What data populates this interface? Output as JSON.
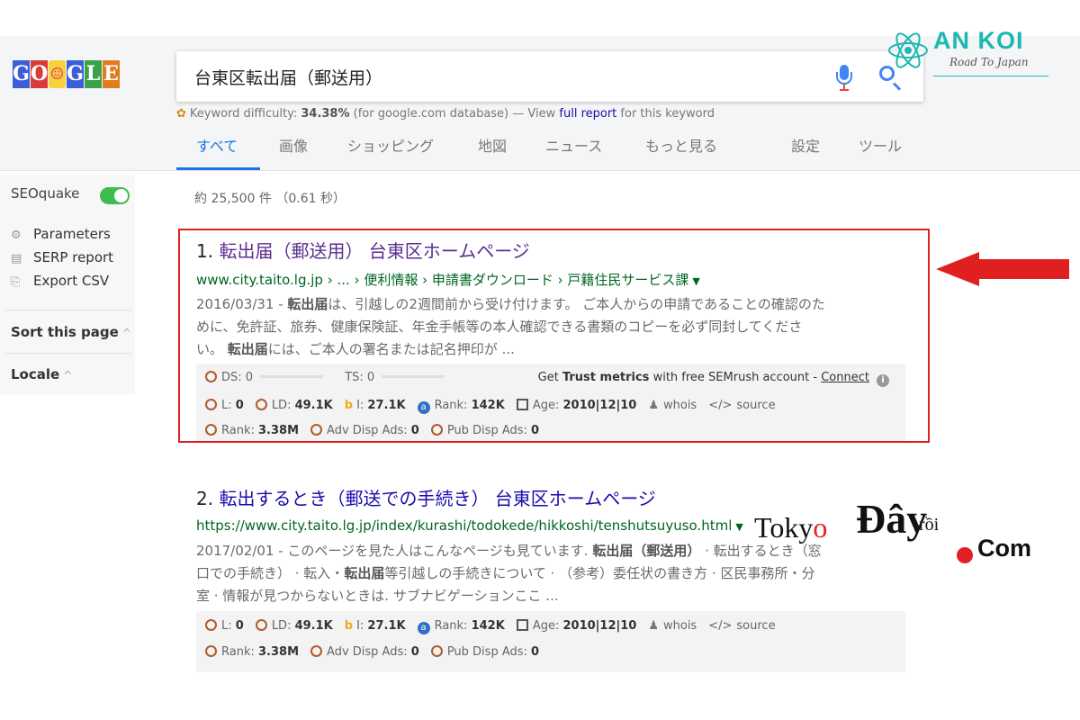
{
  "logo": {
    "letters": [
      "G",
      "O",
      "☺",
      "G",
      "L",
      "E"
    ],
    "colors": [
      "#3b5fd9",
      "#d93b3b",
      "#f6d33c",
      "#3b5fd9",
      "#3aa24a",
      "#e07c1e"
    ]
  },
  "search": {
    "query": "台東区転出届（郵送用）",
    "mic_icon": "mic-icon",
    "search_icon": "search-icon"
  },
  "keyword": {
    "prefix": "Keyword difficulty:",
    "value": "34.38%",
    "db": "(for google.com database) — View",
    "link": "full report",
    "suffix": "for this keyword"
  },
  "tabs": [
    "すべて",
    "画像",
    "ショッピング",
    "地図",
    "ニュース",
    "もっと見る",
    "設定",
    "ツール"
  ],
  "brand": {
    "name": "AN KOI",
    "tagline": "Road To Japan",
    "color": "#1db8b0"
  },
  "sidebar": {
    "seoquake": "SEOquake",
    "items": [
      {
        "icon": "gear-icon",
        "glyph": "⚙",
        "label": "Parameters"
      },
      {
        "icon": "report-icon",
        "glyph": "▤",
        "label": "SERP report"
      },
      {
        "icon": "export-icon",
        "glyph": "⎘",
        "label": "Export CSV"
      }
    ],
    "sort": "Sort this page",
    "locale": "Locale"
  },
  "stats": "約 25,500 件 （0.61 秒）",
  "results": [
    {
      "num": "1.",
      "title": "転出届（郵送用） 台東区ホームページ",
      "url": "www.city.taito.lg.jp › ... › 便利情報 › 申請書ダウンロード › 戸籍住民サービス課",
      "date": "2016/03/31 -",
      "snippet_lines": [
        [
          "",
          "転出届",
          "は、引越しの2週間前から受け付けます。 ご本人からの申請であることの確認のた"
        ],
        [
          "めに、免許証、旅券、健康保険証、年金手帳等の本人確認できる書類のコピーを必ず同封してくださ",
          "",
          ""
        ],
        [
          "い。 ",
          "転出届",
          "には、ご本人の署名または記名押印が ..."
        ]
      ],
      "ds": "DS: 0",
      "ts": "TS: 0",
      "trust": {
        "pre": "Get",
        "bold": "Trust metrics",
        "post": "with free SEMrush account -",
        "link": "Connect"
      }
    },
    {
      "num": "2.",
      "title": "転出するとき（郵送での手続き） 台東区ホームページ",
      "url": "https://www.city.taito.lg.jp/index/kurashi/todokede/hikkoshi/tenshutsuyuso.html",
      "date": "2017/02/01 -",
      "snippet_lines": [
        [
          "このページを見た人はこんなページも見ています. ",
          "転出届（郵送用）",
          " · 転出するとき（窓"
        ],
        [
          "口での手続き） · 転入・",
          "転出届",
          "等引越しの手続きについて · （参考）委任状の書き方 · 区民事務所・分"
        ],
        [
          "室 · 情報が見つからないときは. サブナビゲーションここ ...",
          "",
          ""
        ]
      ]
    }
  ],
  "metrics": {
    "l": "L:",
    "l_val": "0",
    "ld": "LD:",
    "ld_val": "49.1K",
    "i": "I:",
    "i_val": "27.1K",
    "rank": "Rank:",
    "rank_val": "142K",
    "age": "Age:",
    "age_val": "2010|12|10",
    "whois": "whois",
    "source": "source",
    "rank2": "Rank:",
    "rank2_val": "3.38M",
    "adv": "Adv Disp Ads:",
    "adv_val": "0",
    "pub": "Pub Disp Ads:",
    "pub_val": "0"
  },
  "watermark": {
    "tokyo_a": "Toky",
    "tokyo_o": "o",
    "day": "Đây",
    "roi": "rồi",
    "com": "Com"
  },
  "highlight_color": "#e02020"
}
